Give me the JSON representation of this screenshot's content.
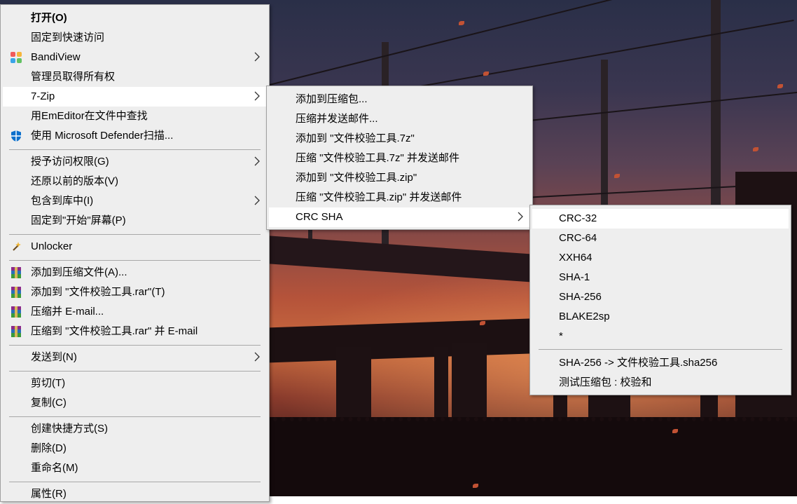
{
  "main_menu": {
    "items": [
      {
        "label": "打开(O)"
      },
      {
        "label": "固定到快速访问"
      },
      {
        "label": "BandiView",
        "icon": "bandiview-icon"
      },
      {
        "label": "管理员取得所有权"
      },
      {
        "label": "7-Zip"
      },
      {
        "label": "用EmEditor在文件中查找"
      },
      {
        "label": "使用 Microsoft Defender扫描...",
        "icon": "defender-shield-icon"
      },
      {
        "label": "授予访问权限(G)"
      },
      {
        "label": "还原以前的版本(V)"
      },
      {
        "label": "包含到库中(I)"
      },
      {
        "label": "固定到\"开始\"屏幕(P)"
      },
      {
        "label": "Unlocker",
        "icon": "unlocker-wand-icon"
      },
      {
        "label": "添加到压缩文件(A)...",
        "icon": "winrar-icon"
      },
      {
        "label": "添加到 \"文件校验工具.rar\"(T)",
        "icon": "winrar-icon"
      },
      {
        "label": "压缩并 E-mail...",
        "icon": "winrar-icon"
      },
      {
        "label": "压缩到 \"文件校验工具.rar\" 并 E-mail",
        "icon": "winrar-icon"
      },
      {
        "label": "发送到(N)"
      },
      {
        "label": "剪切(T)"
      },
      {
        "label": "复制(C)"
      },
      {
        "label": "创建快捷方式(S)"
      },
      {
        "label": "删除(D)"
      },
      {
        "label": "重命名(M)"
      },
      {
        "label": "属性(R)"
      }
    ]
  },
  "sevenzip_menu": {
    "items": [
      {
        "label": "添加到压缩包..."
      },
      {
        "label": "压缩并发送邮件..."
      },
      {
        "label": "添加到 \"文件校验工具.7z\""
      },
      {
        "label": "压缩 \"文件校验工具.7z\" 并发送邮件"
      },
      {
        "label": "添加到 \"文件校验工具.zip\""
      },
      {
        "label": "压缩 \"文件校验工具.zip\" 并发送邮件"
      },
      {
        "label": "CRC SHA"
      }
    ]
  },
  "crc_menu": {
    "items": [
      {
        "label": "CRC-32"
      },
      {
        "label": "CRC-64"
      },
      {
        "label": "XXH64"
      },
      {
        "label": "SHA-1"
      },
      {
        "label": "SHA-256"
      },
      {
        "label": "BLAKE2sp"
      },
      {
        "label": "*"
      },
      {
        "label": "SHA-256 -> 文件校验工具.sha256"
      },
      {
        "label": "测试压缩包 : 校验和"
      }
    ]
  },
  "colors": {
    "menu_bg": "#eeeeee",
    "highlight": "#ffffff",
    "separator": "#a8a8a8"
  }
}
